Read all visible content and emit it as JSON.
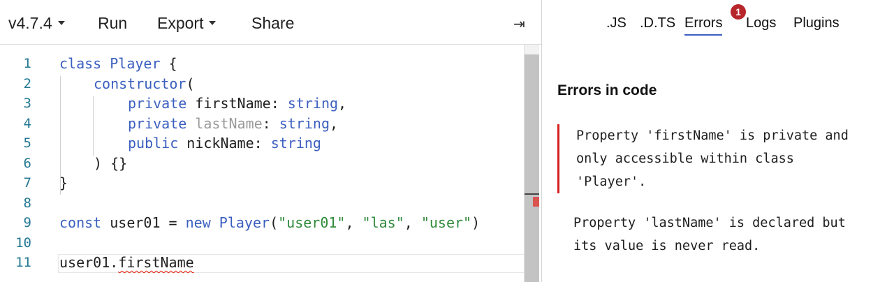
{
  "toolbar": {
    "version": "v4.7.4",
    "run": "Run",
    "export": "Export",
    "share": "Share",
    "collapse_glyph": "⇥"
  },
  "editor": {
    "line_numbers": [
      "1",
      "2",
      "3",
      "4",
      "5",
      "6",
      "7",
      "8",
      "9",
      "10",
      "11"
    ],
    "lines": {
      "l1": {
        "kw": "class",
        "name": " Player",
        "rest": " {"
      },
      "l2": {
        "kw": "constructor",
        "rest": "("
      },
      "l3": {
        "kw": "private",
        "name": " firstName: ",
        "type": "string",
        "rest": ","
      },
      "l4": {
        "kw": "private",
        "name": "lastName",
        "colon": ": ",
        "type": "string",
        "rest": ","
      },
      "l5": {
        "kw": "public",
        "name": " nickName: ",
        "type": "string"
      },
      "l6": {
        "text": ") {}"
      },
      "l7": {
        "text": "}"
      },
      "l9": {
        "kw": "const",
        "name": " user01 = ",
        "kw2": "new",
        "cls": " Player",
        "open": "(",
        "s1": "\"user01\"",
        "sep1": ", ",
        "s2": "\"las\"",
        "sep2": ", ",
        "s3": "\"user\"",
        "close": ")"
      },
      "l11": {
        "obj": "user01.",
        "prop": "firstName"
      }
    }
  },
  "sidebar": {
    "tabs": [
      ".JS",
      ".D.TS",
      "Errors",
      "Logs",
      "Plugins"
    ],
    "active_tab": "Errors",
    "error_count": "1",
    "title": "Errors in code",
    "error_lines": [
      "Property 'firstName' is private and",
      "only accessible within class",
      "'Player'."
    ],
    "warning_lines": [
      "Property 'lastName' is declared but",
      "its value is never read."
    ]
  },
  "colors": {
    "keyword": "#3b5fc0",
    "string": "#2f8a3a",
    "line_number": "#237893",
    "error": "#d42020",
    "badge": "#b7262b"
  }
}
